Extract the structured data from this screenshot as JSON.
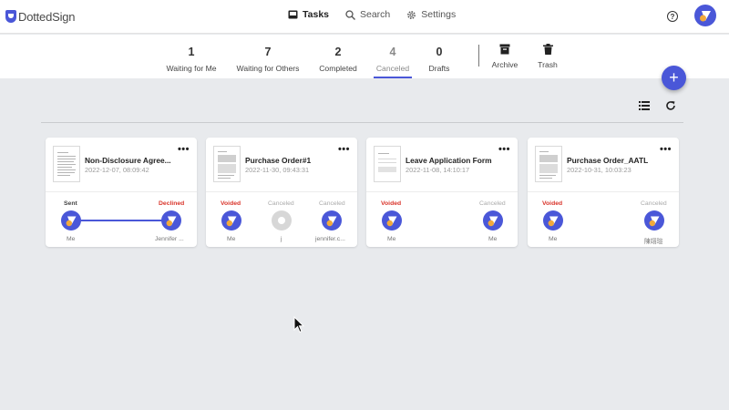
{
  "app": {
    "name": "DottedSign"
  },
  "nav": {
    "tasks": "Tasks",
    "search": "Search",
    "settings": "Settings",
    "help": "?"
  },
  "status_tabs": [
    {
      "count": "1",
      "label": "Waiting for Me"
    },
    {
      "count": "7",
      "label": "Waiting for Others"
    },
    {
      "count": "2",
      "label": "Completed"
    },
    {
      "count": "4",
      "label": "Canceled"
    },
    {
      "count": "0",
      "label": "Drafts"
    }
  ],
  "extra_tabs": {
    "archive": "Archive",
    "trash": "Trash"
  },
  "fab": {
    "label": "+"
  },
  "cards": [
    {
      "title": "Non-Disclosure Agree...",
      "date": "2022-12-07, 08:09:42",
      "signers": [
        {
          "status": "Sent",
          "name": "Me"
        },
        {
          "status": "Declined",
          "name": "Jennifer ..."
        }
      ]
    },
    {
      "title": "Purchase Order#1",
      "date": "2022-11-30, 09:43:31",
      "signers": [
        {
          "status": "Voided",
          "name": "Me"
        },
        {
          "status": "Canceled",
          "name": "j"
        },
        {
          "status": "Canceled",
          "name": "jennifer.c..."
        }
      ]
    },
    {
      "title": "Leave Application Form",
      "date": "2022-11-08, 14:10:17",
      "signers": [
        {
          "status": "Voided",
          "name": "Me"
        },
        {
          "status": "Canceled",
          "name": "Me"
        }
      ]
    },
    {
      "title": "Purchase Order_AATL",
      "date": "2022-10-31, 10:03:23",
      "signers": [
        {
          "status": "Voided",
          "name": "Me"
        },
        {
          "status": "Canceled",
          "name": "陳翊瑄"
        }
      ]
    }
  ],
  "colors": {
    "accent": "#4a57d8",
    "danger": "#d9352b",
    "muted": "#a9a9a9",
    "avatar_dot": "#f2a93b"
  }
}
